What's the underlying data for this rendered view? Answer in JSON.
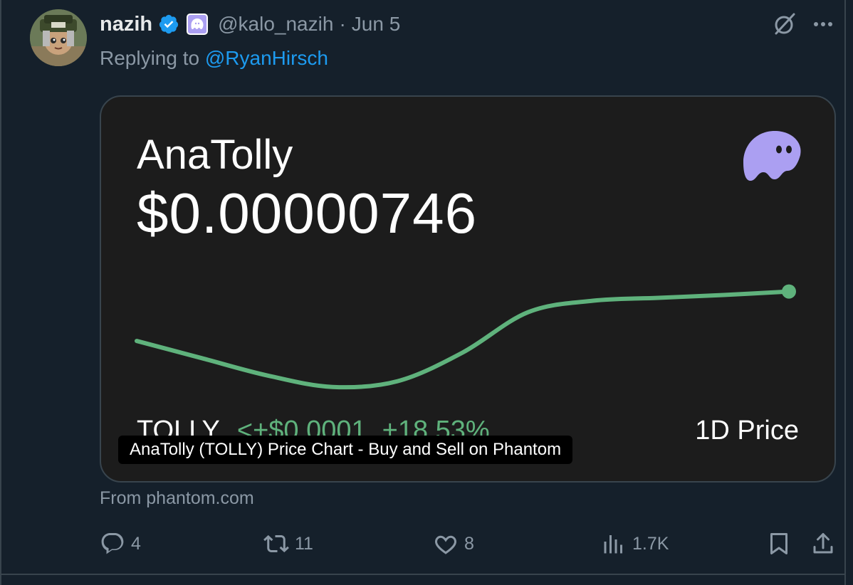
{
  "author": {
    "name": "nazih",
    "handle": "@kalo_nazih",
    "separator": "·",
    "date": "Jun 5"
  },
  "reply": {
    "prefix": "Replying to ",
    "to": "@RyanHirsch"
  },
  "card": {
    "token_name": "AnaTolly",
    "price": "$0.00000746",
    "ticker": "TOLLY",
    "change_abs": "<+$0.0001",
    "change_pct": "+18.53%",
    "period": "1D Price",
    "caption": "AnaTolly (TOLLY) Price Chart - Buy and Sell on Phantom",
    "source": "From phantom.com"
  },
  "actions": {
    "replies": "4",
    "reposts": "11",
    "likes": "8",
    "views": "1.7K"
  },
  "icons": {
    "verified": "verified-badge-icon",
    "affiliate": "phantom-ghost-icon",
    "grok": "grok-icon",
    "more": "more-icon",
    "reply": "reply-icon",
    "repost": "repost-icon",
    "like": "heart-icon",
    "views": "views-icon",
    "bookmark": "bookmark-icon",
    "share": "share-icon"
  },
  "colors": {
    "background": "#15202b",
    "card_background": "#1c1c1c",
    "accent_link": "#1d9bf0",
    "chart_line": "#5fb27c",
    "phantom_purple": "#ab9ff2",
    "muted_text": "#8b98a5"
  },
  "chart_data": {
    "type": "line",
    "title": "",
    "xlabel": "",
    "ylabel": "",
    "series": [
      {
        "values": [
          6.6e-06,
          6.3e-06,
          6e-06,
          5.8e-06,
          5.9e-06,
          6.4e-06,
          7.1e-06,
          7.3e-06,
          7.35e-06,
          7.4e-06,
          7.46e-06
        ]
      }
    ],
    "ylim": [
      5.4e-06,
      8e-06
    ],
    "grid": false,
    "end_marker": true
  }
}
